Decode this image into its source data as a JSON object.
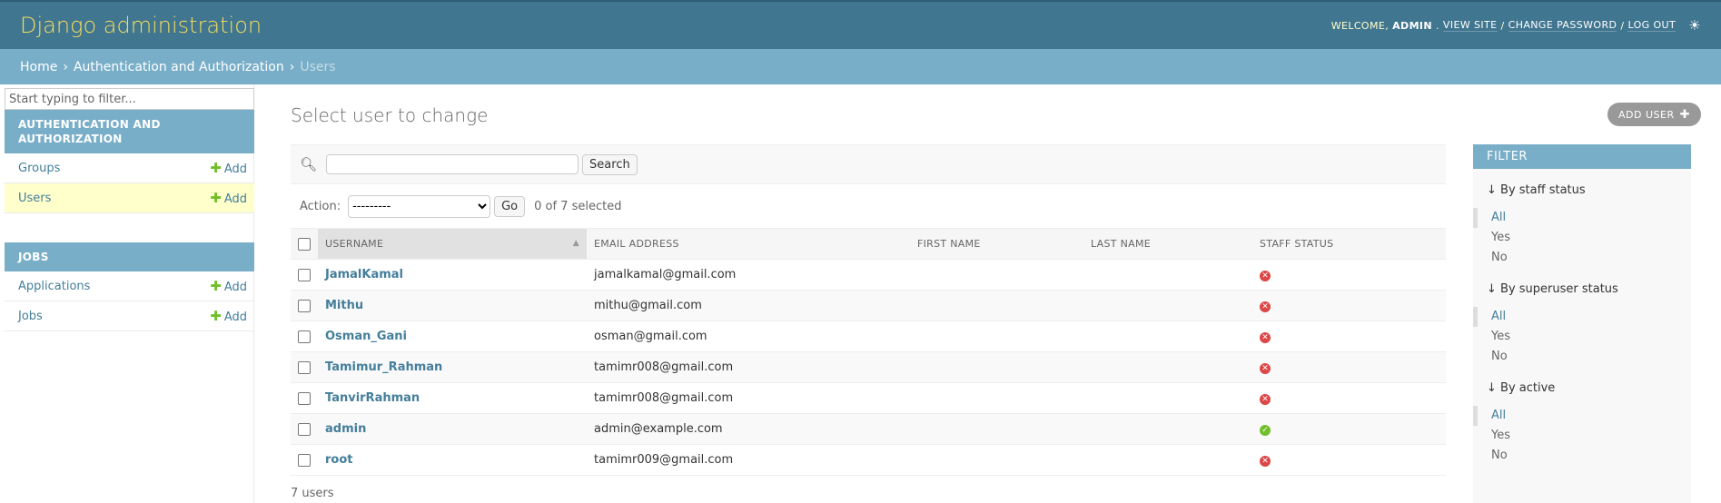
{
  "header": {
    "branding": "Django administration",
    "welcome": "Welcome,",
    "username": "ADMIN",
    "view_site": "View site",
    "change_password": "Change password",
    "log_out": "Log out"
  },
  "breadcrumbs": {
    "home": "Home",
    "app": "Authentication and Authorization",
    "current": "Users"
  },
  "sidebar": {
    "filter_placeholder": "Start typing to filter...",
    "modules": [
      {
        "caption": "Authentication and Authorization",
        "items": [
          {
            "label": "Groups",
            "add": "Add"
          },
          {
            "label": "Users",
            "add": "Add"
          }
        ]
      },
      {
        "caption": "Jobs",
        "items": [
          {
            "label": "Applications",
            "add": "Add"
          },
          {
            "label": "Jobs",
            "add": "Add"
          }
        ]
      }
    ]
  },
  "content": {
    "title": "Select user to change",
    "add_user": "Add user",
    "search_button": "Search",
    "action_label": "Action:",
    "action_selected": "---------",
    "go_button": "Go",
    "selected_count": "0 of 7 selected",
    "columns": [
      "Username",
      "Email address",
      "First name",
      "Last name",
      "Staff status"
    ],
    "rows": [
      {
        "username": "JamalKamal",
        "email": "jamalkamal@gmail.com",
        "first": "",
        "last": "",
        "staff": false
      },
      {
        "username": "Mithu",
        "email": "mithu@gmail.com",
        "first": "",
        "last": "",
        "staff": false
      },
      {
        "username": "Osman_Gani",
        "email": "osman@gmail.com",
        "first": "",
        "last": "",
        "staff": false
      },
      {
        "username": "Tamimur_Rahman",
        "email": "tamimr008@gmail.com",
        "first": "",
        "last": "",
        "staff": false
      },
      {
        "username": "TanvirRahman",
        "email": "tamimr008@gmail.com",
        "first": "",
        "last": "",
        "staff": false
      },
      {
        "username": "admin",
        "email": "admin@example.com",
        "first": "",
        "last": "",
        "staff": true
      },
      {
        "username": "root",
        "email": "tamimr009@gmail.com",
        "first": "",
        "last": "",
        "staff": false
      }
    ],
    "paginator": "7 users"
  },
  "filter": {
    "title": "Filter",
    "sections": [
      {
        "title": "↓ By staff status",
        "options": [
          "All",
          "Yes",
          "No"
        ]
      },
      {
        "title": "↓ By superuser status",
        "options": [
          "All",
          "Yes",
          "No"
        ]
      },
      {
        "title": "↓ By active",
        "options": [
          "All",
          "Yes",
          "No"
        ]
      }
    ]
  },
  "colors": {
    "header_bg": "#417690",
    "breadcrumb_bg": "#79aec8",
    "brand": "#f5dd5d",
    "link": "#447e9b",
    "add_green": "#70bf2b",
    "no_red": "#dd4646"
  }
}
